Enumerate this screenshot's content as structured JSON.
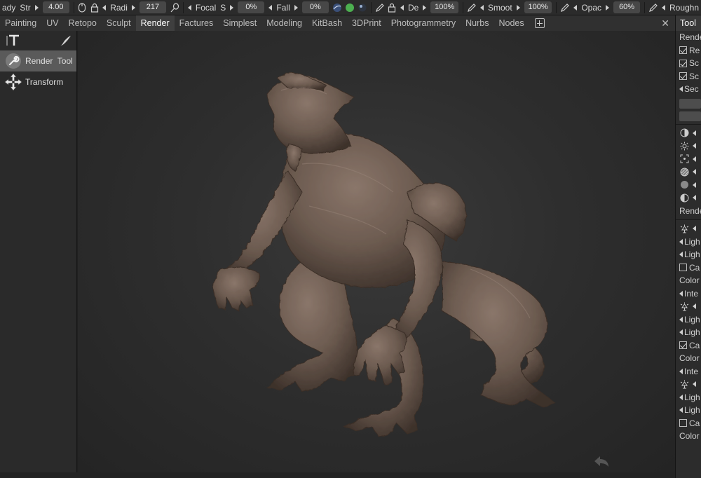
{
  "toolbar": {
    "mode_label": "ady",
    "str_label": "Str",
    "str_value": "4.00",
    "radius_label": "Radi",
    "radius_value": "217",
    "focal_label": "Focal",
    "focal_s_label": "S",
    "focal_value": "0%",
    "falloff_label": "Fall",
    "falloff_value": "0%",
    "depth_label": "De",
    "depth_value": "100%",
    "smooth_label": "Smoot",
    "smooth_value": "100%",
    "opacity_label": "Opac",
    "opacity_value": "60%",
    "roughness_label": "Roughn"
  },
  "tabs": [
    {
      "label": "Painting",
      "active": false
    },
    {
      "label": "UV",
      "active": false
    },
    {
      "label": "Retopo",
      "active": false
    },
    {
      "label": "Sculpt",
      "active": false
    },
    {
      "label": "Render",
      "active": true
    },
    {
      "label": "Factures",
      "active": false
    },
    {
      "label": "Simplest",
      "active": false
    },
    {
      "label": "Modeling",
      "active": false
    },
    {
      "label": "KitBash",
      "active": false
    },
    {
      "label": "3DPrint",
      "active": false
    },
    {
      "label": "Photogrammetry",
      "active": false
    },
    {
      "label": "Nurbs",
      "active": false
    },
    {
      "label": "Nodes",
      "active": false
    }
  ],
  "left_panel": {
    "items": [
      {
        "label": "Render  Tool",
        "icon": "wrench-icon",
        "selected": true
      },
      {
        "label": "Transform",
        "icon": "move-arrows-icon",
        "selected": false
      }
    ]
  },
  "right_panel": {
    "header": "Tool",
    "rows": [
      {
        "type": "text",
        "label": "Rende"
      },
      {
        "type": "check",
        "label": "Re",
        "checked": true
      },
      {
        "type": "check",
        "label": "Sc",
        "checked": true
      },
      {
        "type": "check",
        "label": "Sc",
        "checked": true
      },
      {
        "type": "arrow",
        "label": "Sec"
      },
      {
        "type": "bar"
      },
      {
        "type": "bar"
      },
      {
        "type": "sep"
      },
      {
        "type": "icon",
        "icon": "exposure-icon"
      },
      {
        "type": "icon",
        "icon": "sun-icon"
      },
      {
        "type": "icon",
        "icon": "focus-icon"
      },
      {
        "type": "icon",
        "icon": "hatch-icon"
      },
      {
        "type": "icon",
        "icon": "sphere-icon"
      },
      {
        "type": "icon",
        "icon": "contrast-icon"
      },
      {
        "type": "text",
        "label": "Rende"
      },
      {
        "type": "sep"
      },
      {
        "type": "icon",
        "icon": "light-icon"
      },
      {
        "type": "arrow",
        "label": "Ligh"
      },
      {
        "type": "arrow",
        "label": "Ligh"
      },
      {
        "type": "check",
        "label": "Ca",
        "checked": false
      },
      {
        "type": "text",
        "label": "Color"
      },
      {
        "type": "arrow",
        "label": "Inte"
      },
      {
        "type": "icon",
        "icon": "light-icon"
      },
      {
        "type": "arrow",
        "label": "Ligh"
      },
      {
        "type": "arrow",
        "label": "Ligh"
      },
      {
        "type": "check",
        "label": "Ca",
        "checked": true
      },
      {
        "type": "text",
        "label": "Color"
      },
      {
        "type": "arrow",
        "label": "Inte"
      },
      {
        "type": "icon",
        "icon": "light-icon"
      },
      {
        "type": "arrow",
        "label": "Ligh"
      },
      {
        "type": "arrow",
        "label": "Ligh"
      },
      {
        "type": "check",
        "label": "Ca",
        "checked": false
      },
      {
        "type": "text",
        "label": "Color"
      }
    ]
  },
  "colors": {
    "model": "#6b5a4f",
    "green_dot": "#4caf50",
    "active_tab": "#3f3f3f"
  }
}
